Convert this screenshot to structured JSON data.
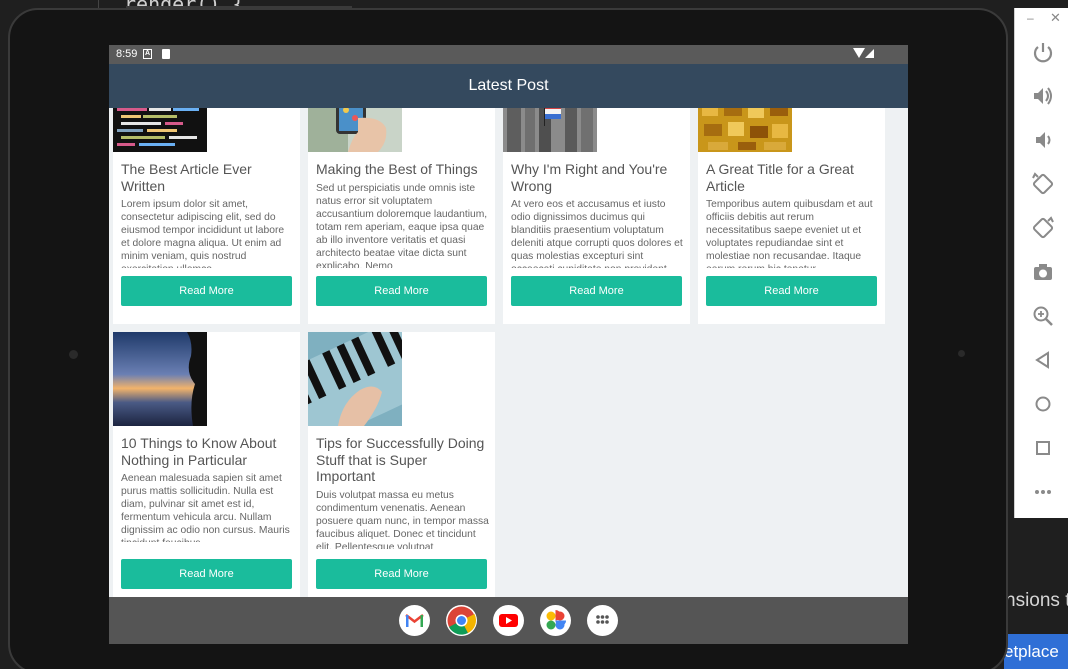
{
  "editor": {
    "code_text": "render() {",
    "panel_text": "nsions t",
    "marketplace_text": "etplace"
  },
  "status_bar": {
    "time": "8:59"
  },
  "app_bar": {
    "title": "Latest Post"
  },
  "posts": [
    {
      "title": "The Best Article Ever Written",
      "excerpt": "Lorem ipsum dolor sit amet, consectetur adipiscing elit, sed do eiusmod tempor incididunt ut labore et dolore magna aliqua. Ut enim ad minim veniam, quis nostrud exercitation ullamco",
      "button": "Read More",
      "image": "code-screen"
    },
    {
      "title": "Making the Best of Things",
      "excerpt": "Sed ut perspiciatis unde omnis iste natus error sit voluptatem accusantium doloremque laudantium, totam rem aperiam, eaque ipsa quae ab illo inventore veritatis et quasi architecto beatae vitae dicta sunt explicabo. Nemo",
      "button": "Read More",
      "image": "hand-phone"
    },
    {
      "title": "Why I'm Right and You're Wrong",
      "excerpt": "At vero eos et accusamus et iusto odio dignissimos ducimus qui blanditiis praesentium voluptatum deleniti atque corrupti quos dolores et quas molestias excepturi sint occaecati cupiditate non provident,",
      "button": "Read More",
      "image": "building-flag"
    },
    {
      "title": "A Great Title for a Great Article",
      "excerpt": "Temporibus autem quibusdam et aut officiis debitis aut rerum necessitatibus saepe eveniet ut et voluptates repudiandae sint et molestiae non recusandae. Itaque earum rerum hic tenetur",
      "button": "Read More",
      "image": "gold-pattern"
    },
    {
      "title": "10 Things to Know About Nothing in Particular",
      "excerpt": "Aenean malesuada sapien sit amet purus mattis sollicitudin. Nulla est diam, pulvinar sit amet est id, fermentum vehicula arcu. Nullam dignissim ac odio non cursus. Mauris tincidunt faucibus",
      "button": "Read More",
      "image": "sunset-silhouette"
    },
    {
      "title": "Tips for Successfully Doing Stuff that is Super Important",
      "excerpt": "Duis volutpat massa eu metus condimentum venenatis. Aenean posuere quam nunc, in tempor massa faucibus aliquet. Donec et tincidunt elit. Pellentesque volutpat",
      "button": "Read More",
      "image": "piano-hand"
    }
  ],
  "dock": [
    "gmail-icon",
    "chrome-icon",
    "youtube-icon",
    "photos-icon",
    "app-drawer-icon"
  ],
  "emulator_controls": [
    "power-icon",
    "volume-up-icon",
    "volume-down-icon",
    "rotate-left-icon",
    "rotate-right-icon",
    "camera-icon",
    "zoom-icon",
    "back-icon",
    "home-icon",
    "overview-icon",
    "more-icon"
  ],
  "colors": {
    "app_bar": "#34495e",
    "button": "#1abc9c",
    "screen_bg": "#eef1f3"
  }
}
